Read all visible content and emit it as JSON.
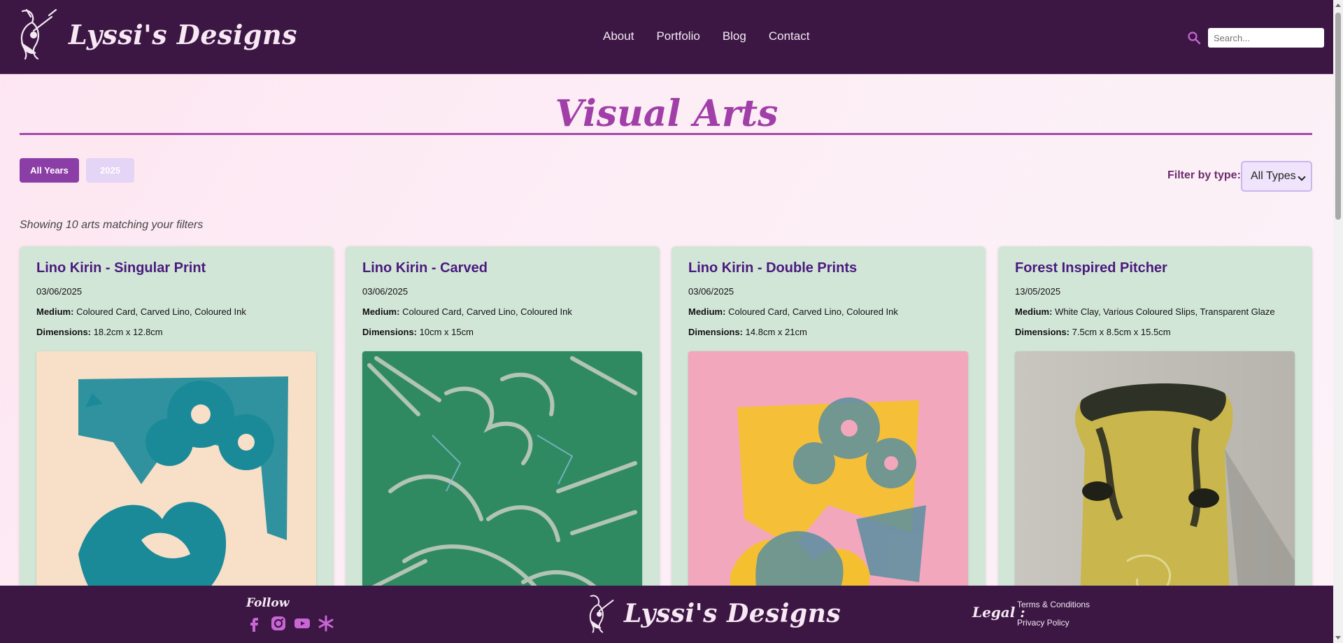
{
  "header": {
    "brand": "Lyssi's Designs",
    "nav": [
      "About",
      "Portfolio",
      "Blog",
      "Contact"
    ],
    "search_placeholder": "Search..."
  },
  "page": {
    "title": "Visual Arts",
    "year_filters": [
      "All Years",
      "2025"
    ],
    "active_year": "All Years",
    "filter_label": "Filter by type:",
    "filter_selected": "All Types",
    "results_text": "Showing 10 arts matching your filters"
  },
  "cards": [
    {
      "title": "Lino Kirin - Singular Print",
      "date": "03/06/2025",
      "medium_label": "Medium:",
      "medium": "Coloured Card, Carved Lino, Coloured Ink",
      "dimensions_label": "Dimensions:",
      "dimensions": "18.2cm x 12.8cm"
    },
    {
      "title": "Lino Kirin - Carved",
      "date": "03/06/2025",
      "medium_label": "Medium:",
      "medium": "Coloured Card, Carved Lino, Coloured Ink",
      "dimensions_label": "Dimensions:",
      "dimensions": "10cm x 15cm"
    },
    {
      "title": "Lino Kirin - Double Prints",
      "date": "03/06/2025",
      "medium_label": "Medium:",
      "medium": "Coloured Card, Carved Lino, Coloured Ink",
      "dimensions_label": "Dimensions:",
      "dimensions": "14.8cm x 21cm"
    },
    {
      "title": "Forest Inspired Pitcher",
      "date": "13/05/2025",
      "medium_label": "Medium:",
      "medium": "White Clay, Various Coloured Slips, Transparent Glaze",
      "dimensions_label": "Dimensions:",
      "dimensions": "7.5cm x 8.5cm x 15.5cm"
    }
  ],
  "footer": {
    "follow_label": "Follow",
    "social_icons": [
      "facebook-icon",
      "instagram-icon",
      "youtube-icon",
      "linktree-icon"
    ],
    "brand": "Lyssi's Designs",
    "legal_label": "Legal :",
    "legal_links": [
      "Terms & Conditions",
      "Privacy Policy"
    ]
  },
  "colors": {
    "header_bg": "#3c1744",
    "accent_purple": "#a13fa8",
    "card_bg": "#d2e6d8",
    "page_bg": "#fde6f1"
  }
}
